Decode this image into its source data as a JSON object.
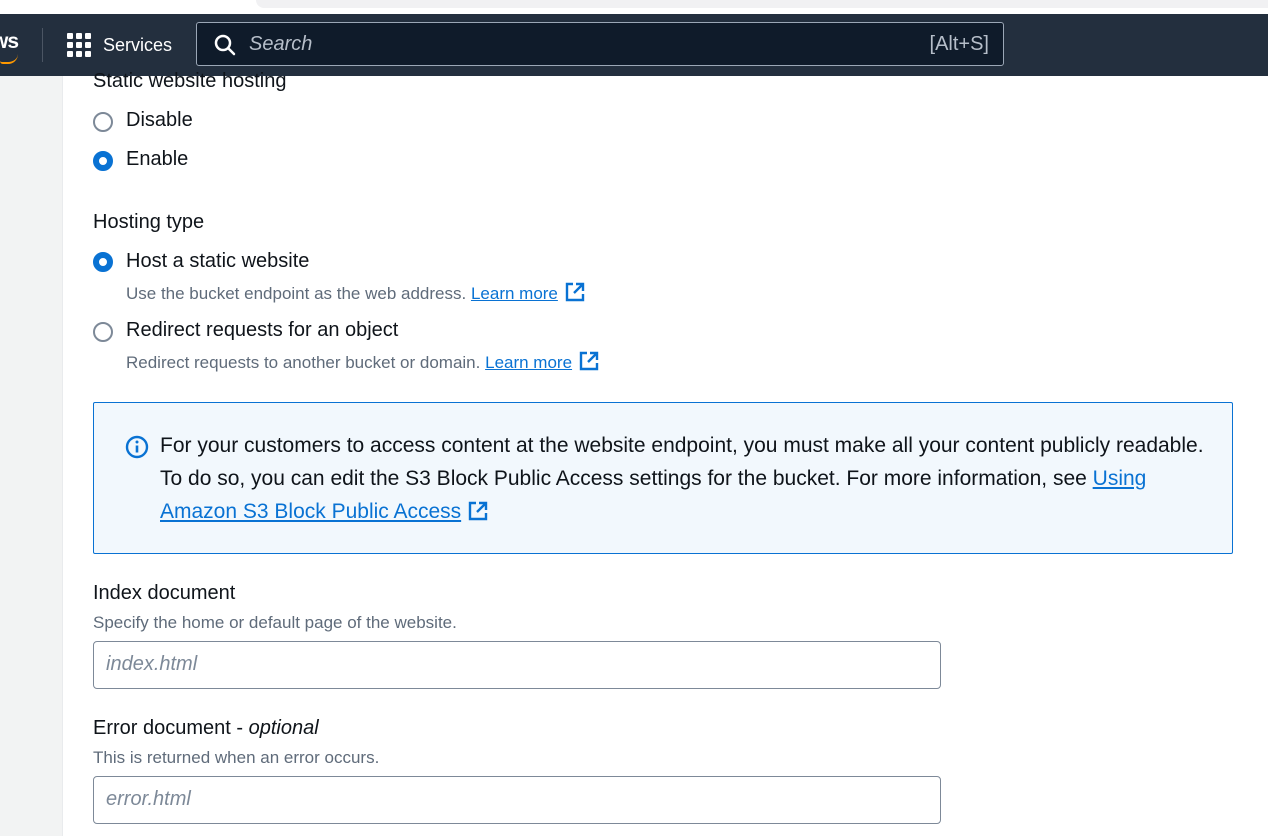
{
  "navbar": {
    "logo_text": "ws",
    "services_label": "Services",
    "search": {
      "placeholder": "Search",
      "shortcut": "[Alt+S]"
    }
  },
  "static_hosting": {
    "label": "Static website hosting",
    "options": [
      {
        "label": "Disable",
        "selected": false
      },
      {
        "label": "Enable",
        "selected": true
      }
    ]
  },
  "hosting_type": {
    "label": "Hosting type",
    "options": [
      {
        "label": "Host a static website",
        "description": "Use the bucket endpoint as the web address.",
        "link": "Learn more",
        "selected": true
      },
      {
        "label": "Redirect requests for an object",
        "description": "Redirect requests to another bucket or domain.",
        "link": "Learn more",
        "selected": false
      }
    ]
  },
  "info_alert": {
    "text": "For your customers to access content at the website endpoint, you must make all your content publicly readable. To do so, you can edit the S3 Block Public Access settings for the bucket. For more information, see",
    "link": "Using Amazon S3 Block Public Access"
  },
  "index_document": {
    "label": "Index document",
    "description": "Specify the home or default page of the website.",
    "placeholder": "index.html"
  },
  "error_document": {
    "label": "Error document",
    "optional": "optional",
    "description": "This is returned when an error occurs.",
    "placeholder": "error.html"
  },
  "colors": {
    "accent": "#0972d3",
    "navbar": "#232f3e",
    "info_bg": "#f2f8fd"
  }
}
